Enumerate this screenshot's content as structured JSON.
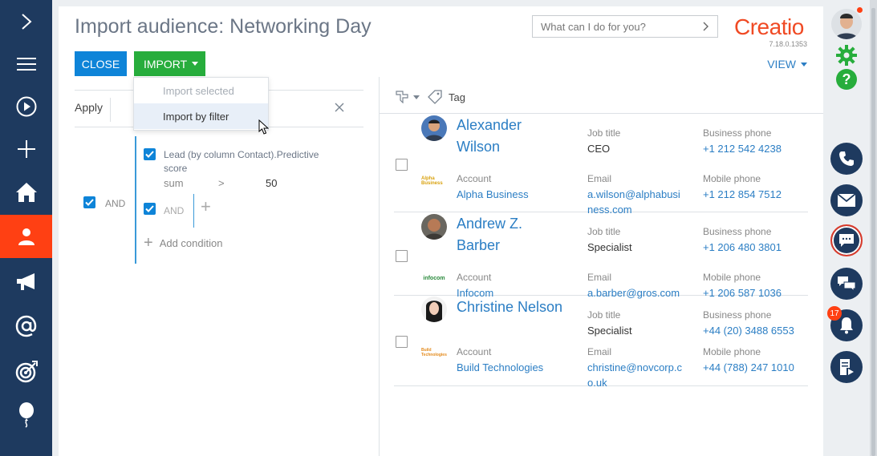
{
  "app": {
    "logo": "Creatio",
    "version": "7.18.0.1353"
  },
  "page": {
    "title": "Import audience: Networking Day"
  },
  "search": {
    "placeholder": "What can I do for you?"
  },
  "toolbar": {
    "close_label": "CLOSE",
    "import_label": "IMPORT",
    "view_label": "VIEW"
  },
  "import_menu": {
    "items": [
      {
        "label": "Import selected",
        "state": "disabled"
      },
      {
        "label": "Import by filter",
        "state": "hover"
      }
    ]
  },
  "filter": {
    "apply_label": "Apply",
    "root_group_label": "AND",
    "condition": {
      "label": "Lead (by column Contact).Predictive score",
      "aggregate": "sum",
      "operator": ">",
      "value": "50"
    },
    "subgroup_label": "AND",
    "add_condition_label": "Add condition"
  },
  "tags": {
    "tag_label": "Tag"
  },
  "contacts": [
    {
      "name_line1": "Alexander",
      "name_line2": "Wilson",
      "job_title_label": "Job title",
      "job_title": "CEO",
      "business_phone_label": "Business phone",
      "business_phone": "+1 212 542 4238",
      "account_label": "Account",
      "account": "Alpha Business",
      "account_logo_text": "Alpha Business",
      "email_label": "Email",
      "email_line1": "a.wilson@alphabusi",
      "email_line2": "ness.com",
      "mobile_phone_label": "Mobile phone",
      "mobile_phone": "+1 212 854 7512"
    },
    {
      "name_line1": "Andrew Z.",
      "name_line2": "Barber",
      "job_title_label": "Job title",
      "job_title": "Specialist",
      "business_phone_label": "Business phone",
      "business_phone": "+1 206 480 3801",
      "account_label": "Account",
      "account": "Infocom",
      "account_logo_text": "infocom",
      "email_label": "Email",
      "email_line1": "a.barber@gros.com",
      "email_line2": "",
      "mobile_phone_label": "Mobile phone",
      "mobile_phone": "+1 206 587 1036"
    },
    {
      "name_line1": "Christine Nelson",
      "name_line2": "",
      "job_title_label": "Job title",
      "job_title": "Specialist",
      "business_phone_label": "Business phone",
      "business_phone": "+44 (20) 3488 6553",
      "account_label": "Account",
      "account": "Build Technologies",
      "account_logo_text": "Build Technologies",
      "email_label": "Email",
      "email_line1": "christine@novcorp.c",
      "email_line2": "o.uk",
      "mobile_phone_label": "Mobile phone",
      "mobile_phone": "+44 (788) 247 1010"
    }
  ],
  "rightbar": {
    "notifications_count": "17"
  },
  "colors": {
    "sidebar": "#1e3a5f",
    "active": "#ff4013",
    "close_button": "#0e84d8",
    "import_button": "#27ad3c",
    "link": "#2b7ec4",
    "brand": "#f04a24"
  }
}
